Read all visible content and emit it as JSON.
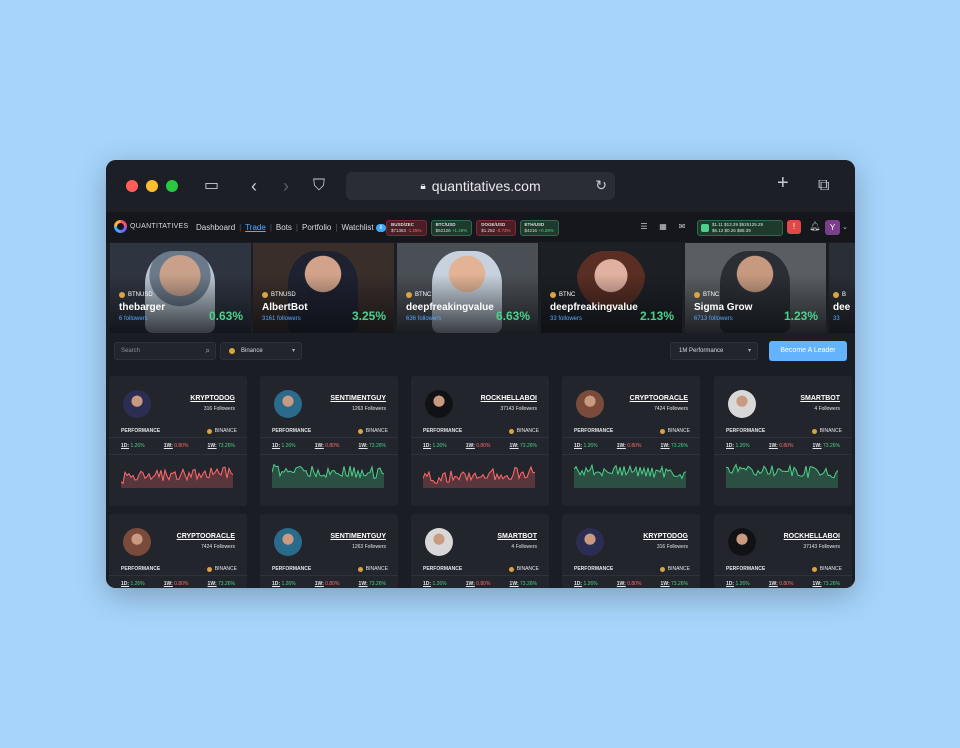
{
  "browser": {
    "url": "quantitatives.com"
  },
  "brand": {
    "name": "QUANTITATIVES"
  },
  "nav": {
    "dashboard": "Dashboard",
    "trade": "Trade",
    "bots": "Bots",
    "portfolio": "Portfolio",
    "watchlist": "Watchlist",
    "watchlist_count": "6"
  },
  "tickers": [
    {
      "sym": "BUSD/ZEC",
      "price": "$71363",
      "change": "-1.25%",
      "dir": "neg"
    },
    {
      "sym": "BTC/USD",
      "price": "$52126",
      "change": "+1.46%",
      "dir": "pos"
    },
    {
      "sym": "DOGE/USD",
      "price": "$1.252",
      "change": "-0.73%",
      "dir": "neg"
    },
    {
      "sym": "ETH/USD",
      "price": "$4216",
      "change": "+0.28%",
      "dir": "pos"
    }
  ],
  "wallet": {
    "line1": "$1.11  $13.29  $525125.29",
    "line2": "$6.12  $0.26     $88.39"
  },
  "hero": [
    {
      "exchange": "BTNUSD",
      "name": "thebarger",
      "followers": "6 followers",
      "pct": "0.63%"
    },
    {
      "exchange": "BTNUSD",
      "name": "AlbertBot",
      "followers": "3161 followers",
      "pct": "3.25%"
    },
    {
      "exchange": "BTNC",
      "name": "deepfreakingvalue",
      "followers": "636 followers",
      "pct": "6.63%"
    },
    {
      "exchange": "BTNC",
      "name": "deepfreakingvalue",
      "followers": "33 followers",
      "pct": "2.13%"
    },
    {
      "exchange": "BTNC",
      "name": "Sigma Grow",
      "followers": "6713 followers",
      "pct": "1.23%"
    },
    {
      "exchange": "B",
      "name": "dee",
      "followers": "33",
      "pct": ""
    }
  ],
  "filters": {
    "search_placeholder": "Search",
    "exchange": "Binance",
    "period": "1M Performance",
    "become_leader": "Become A Leader"
  },
  "card_labels": {
    "performance": "PERFORMANCE",
    "exchange": "BINANCE",
    "d1": "1D:",
    "w1a": "1W:",
    "w1b": "1W:"
  },
  "cards": [
    {
      "name": "KRYPTODOG",
      "followers": "316 Followers",
      "d1": "1.26%",
      "w1": "0.80%",
      "w1b": "73.26%",
      "trend": "red"
    },
    {
      "name": "SENTIMENTGUY",
      "followers": "1263 Followers",
      "d1": "1.26%",
      "w1": "0.80%",
      "w1b": "73.26%",
      "trend": "green"
    },
    {
      "name": "ROCKHELLABOI",
      "followers": "37143 Followers",
      "d1": "1.26%",
      "w1": "0.80%",
      "w1b": "73.26%",
      "trend": "red"
    },
    {
      "name": "CRYPTOORACLE",
      "followers": "7424 Followers",
      "d1": "1.26%",
      "w1": "0.80%",
      "w1b": "73.26%",
      "trend": "green"
    },
    {
      "name": "SMARTBOT",
      "followers": "4 Followers",
      "d1": "1.26%",
      "w1": "0.80%",
      "w1b": "73.26%",
      "trend": "green"
    },
    {
      "name": "CRYPTOORACLE",
      "followers": "7424 Followers",
      "d1": "1.26%",
      "w1": "0.80%",
      "w1b": "73.26%",
      "trend": "green"
    },
    {
      "name": "SENTIMENTGUY",
      "followers": "1263 Followers",
      "d1": "1.26%",
      "w1": "0.80%",
      "w1b": "73.26%",
      "trend": "green"
    },
    {
      "name": "SMARTBOT",
      "followers": "4 Followers",
      "d1": "1.26%",
      "w1": "0.80%",
      "w1b": "73.26%",
      "trend": "green"
    },
    {
      "name": "KRYPTODOG",
      "followers": "316 Followers",
      "d1": "1.26%",
      "w1": "0.80%",
      "w1b": "73.26%",
      "trend": "green"
    },
    {
      "name": "ROCKHELLABOI",
      "followers": "37143 Followers",
      "d1": "1.26%",
      "w1": "0.80%",
      "w1b": "73.26%",
      "trend": "green"
    }
  ],
  "colors": {
    "up": "#4cd18b",
    "down": "#ff6b6b",
    "accent": "#63b3ff",
    "background": "#a6d4fb"
  }
}
